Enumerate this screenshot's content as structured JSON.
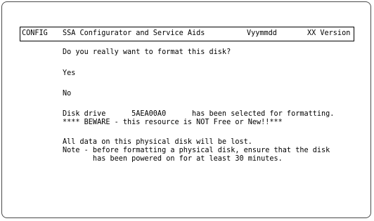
{
  "header": {
    "screen_id": "CONFIG",
    "title": "SSA Configurator and Service Aids",
    "date": "Vyymmdd",
    "version": "XX Version"
  },
  "dialog": {
    "question": "Do you really want to format this disk?",
    "options": [
      {
        "label": "Yes"
      },
      {
        "label": "No"
      }
    ],
    "disk_line": "Disk drive      5AEA00A0      has been selected for formatting.",
    "warning_line": "**** BEWARE - this resource is NOT Free or New!!***",
    "data_loss_line": "All data on this physical disk will be lost.",
    "note_line_1": "Note - before formatting a physical disk, ensure that the disk",
    "note_line_2": "       has been powered on for at least 30 minutes."
  }
}
